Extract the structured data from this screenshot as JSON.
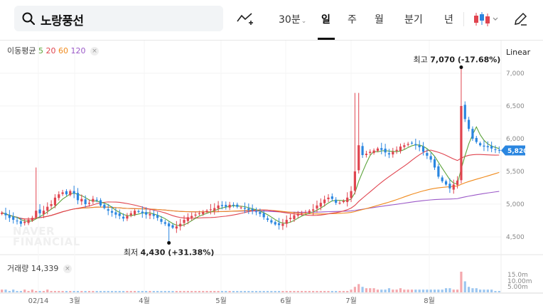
{
  "toolbar": {
    "stock_name": "노랑풍선",
    "interval_label": "30분",
    "tabs": [
      "일",
      "주",
      "월",
      "분기",
      "년"
    ],
    "active_tab": "일"
  },
  "legend": {
    "ma_label": "이동평균",
    "ma_periods": [
      "5",
      "20",
      "60",
      "120"
    ],
    "scale_label": "Linear",
    "volume_label": "거래량",
    "volume_value": "14,339"
  },
  "watermark": [
    "NAVER",
    "FINANCIAL"
  ],
  "annotations": {
    "high_label": "최고",
    "high_value": "7,070",
    "high_change": "(-17.68%)",
    "low_label": "최저",
    "low_value": "4,430",
    "low_change": "(+31.38%)"
  },
  "colors": {
    "up": "#e0444f",
    "down": "#2a86e0",
    "ma5": "#5ba33a",
    "ma20": "#e0444f",
    "ma60": "#f08a1c",
    "ma120": "#9b59c8",
    "current_price_bg": "#2a86e0"
  },
  "chart_data": {
    "type": "candlestick",
    "price_ticks": [
      "7,000",
      "6,500",
      "6,000",
      "5,500",
      "5,000",
      "4,500"
    ],
    "current_price": 5820,
    "current_price_label": "5,820",
    "volume_ticks": [
      "15.0m",
      "10.00m",
      "5.00m"
    ],
    "x_labels": [
      "02/14",
      "3월",
      "4월",
      "5월",
      "6월",
      "7월",
      "8월"
    ],
    "high": 7070,
    "low": 4430,
    "closes": [
      4870,
      4830,
      4790,
      4760,
      4740,
      4700,
      4730,
      4760,
      4790,
      4900,
      4860,
      4900,
      4960,
      5000,
      5100,
      5150,
      5180,
      5150,
      5200,
      5160,
      5060,
      5080,
      5000,
      5020,
      5080,
      5060,
      4980,
      4940,
      4900,
      4870,
      4840,
      4820,
      4780,
      4820,
      4860,
      4900,
      4880,
      4860,
      4840,
      4850,
      4820,
      4790,
      4730,
      4700,
      4660,
      4640,
      4660,
      4700,
      4760,
      4800,
      4820,
      4840,
      4860,
      4880,
      4900,
      4920,
      4940,
      4980,
      4970,
      4960,
      4990,
      4980,
      4960,
      4950,
      4930,
      4910,
      4900,
      4880,
      4850,
      4800,
      4760,
      4720,
      4690,
      4680,
      4700,
      4760,
      4790,
      4830,
      4850,
      4860,
      4880,
      4900,
      4920,
      4980,
      5020,
      5070,
      5100,
      5080,
      5020,
      5020,
      5050,
      5100,
      5200,
      5500,
      5900,
      5750,
      5770,
      5800,
      5820,
      5850,
      5830,
      5790,
      5760,
      5800,
      5830,
      5880,
      5900,
      5920,
      5930,
      5900,
      5870,
      5800,
      5740,
      5680,
      5560,
      5420,
      5350,
      5300,
      5240,
      5300,
      5360,
      6500,
      6300,
      6150,
      6000,
      5950,
      5900,
      5880,
      5870,
      5850,
      5830,
      5820
    ],
    "volume": [
      2,
      2,
      1,
      2,
      1,
      1,
      2,
      1,
      2,
      1,
      1,
      1,
      2,
      1,
      1,
      1,
      1,
      1,
      1,
      1,
      1,
      1,
      1,
      1,
      1,
      1,
      1,
      1,
      1,
      1,
      1,
      1,
      1,
      1,
      1,
      1,
      1,
      1,
      1,
      1,
      1,
      1,
      1,
      1,
      1,
      1,
      1,
      1,
      1,
      1,
      1,
      1,
      1,
      1,
      1,
      1,
      1,
      1,
      1,
      1,
      1,
      1,
      1,
      1,
      1,
      1,
      1,
      1,
      1,
      1,
      1,
      1,
      1,
      1,
      1,
      1,
      1,
      1,
      1,
      1,
      1,
      1,
      1,
      1,
      1,
      1,
      1,
      1,
      1,
      1,
      1,
      1,
      2,
      4,
      6,
      4,
      3,
      3,
      3,
      2,
      2,
      2,
      3,
      2,
      2,
      3,
      2,
      2,
      2,
      2,
      2,
      2,
      2,
      2,
      2,
      2,
      2,
      3,
      3,
      2,
      2,
      15,
      8,
      4,
      3,
      3,
      2,
      2,
      2,
      2,
      1,
      1
    ]
  }
}
